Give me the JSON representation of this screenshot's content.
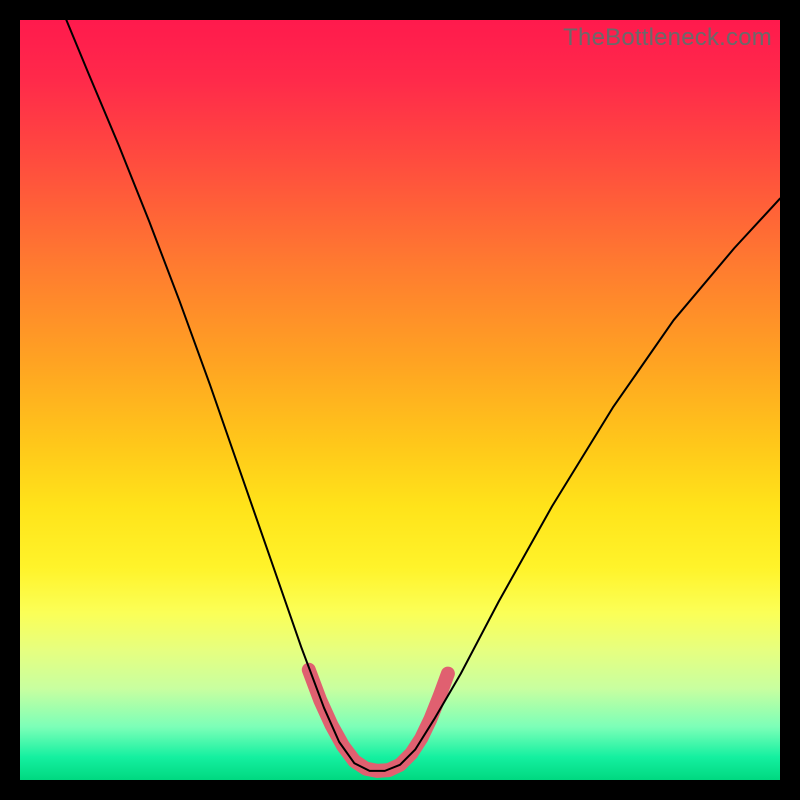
{
  "watermark": "TheBottleneck.com",
  "chart_data": {
    "type": "line",
    "title": "",
    "xlabel": "",
    "ylabel": "",
    "xlim": [
      0,
      1
    ],
    "ylim": [
      0,
      1
    ],
    "series": [
      {
        "name": "black-curve",
        "color": "#000000",
        "stroke_width": 2,
        "points": [
          {
            "x": 0.061,
            "y": 1.0
          },
          {
            "x": 0.09,
            "y": 0.93
          },
          {
            "x": 0.13,
            "y": 0.835
          },
          {
            "x": 0.17,
            "y": 0.735
          },
          {
            "x": 0.21,
            "y": 0.63
          },
          {
            "x": 0.25,
            "y": 0.52
          },
          {
            "x": 0.29,
            "y": 0.405
          },
          {
            "x": 0.33,
            "y": 0.29
          },
          {
            "x": 0.37,
            "y": 0.175
          },
          {
            "x": 0.4,
            "y": 0.095
          },
          {
            "x": 0.42,
            "y": 0.05
          },
          {
            "x": 0.44,
            "y": 0.022
          },
          {
            "x": 0.46,
            "y": 0.012
          },
          {
            "x": 0.48,
            "y": 0.012
          },
          {
            "x": 0.5,
            "y": 0.02
          },
          {
            "x": 0.52,
            "y": 0.04
          },
          {
            "x": 0.545,
            "y": 0.08
          },
          {
            "x": 0.58,
            "y": 0.14
          },
          {
            "x": 0.63,
            "y": 0.235
          },
          {
            "x": 0.7,
            "y": 0.36
          },
          {
            "x": 0.78,
            "y": 0.49
          },
          {
            "x": 0.86,
            "y": 0.605
          },
          {
            "x": 0.94,
            "y": 0.7
          },
          {
            "x": 1.0,
            "y": 0.765
          }
        ]
      },
      {
        "name": "pink-highlight",
        "color": "#e06070",
        "stroke_width": 14,
        "points": [
          {
            "x": 0.38,
            "y": 0.145
          },
          {
            "x": 0.395,
            "y": 0.105
          },
          {
            "x": 0.41,
            "y": 0.072
          },
          {
            "x": 0.425,
            "y": 0.045
          },
          {
            "x": 0.44,
            "y": 0.025
          },
          {
            "x": 0.455,
            "y": 0.015
          },
          {
            "x": 0.47,
            "y": 0.012
          },
          {
            "x": 0.485,
            "y": 0.013
          },
          {
            "x": 0.5,
            "y": 0.02
          },
          {
            "x": 0.515,
            "y": 0.035
          },
          {
            "x": 0.528,
            "y": 0.055
          },
          {
            "x": 0.54,
            "y": 0.08
          },
          {
            "x": 0.552,
            "y": 0.11
          },
          {
            "x": 0.563,
            "y": 0.14
          }
        ]
      }
    ]
  }
}
